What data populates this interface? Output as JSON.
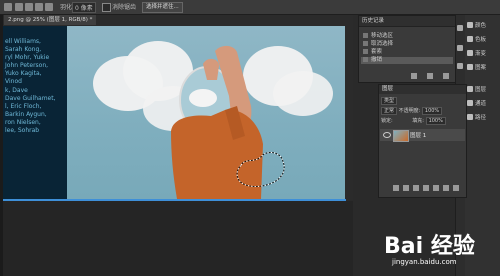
{
  "options_bar": {
    "feather_label": "羽化:",
    "feather_value": "0 像素",
    "antialias_label": "消除锯齿",
    "select_subject_label": "选择并遮住..."
  },
  "document": {
    "tab_title": "2.png @ 25% (图层 1, RGB/8) *",
    "credit_names": [
      "ell Williams,",
      "Sarah Kong,",
      "ryl Mohr, Yukie",
      "John Peterson,",
      "Yuko Kagita,",
      "Vinod",
      "k, Dave",
      "Dave Guilhamet,",
      "l, Eric Floch,",
      "Barkin Aygun,",
      "ron Nielsen,",
      "lee, Sohrab"
    ]
  },
  "history_panel": {
    "title": "历史记录",
    "items": [
      {
        "label": "移动选区"
      },
      {
        "label": "取消选择"
      },
      {
        "label": "套索"
      },
      {
        "label": "撤销",
        "selected": true
      }
    ]
  },
  "right_panel": {
    "items": [
      {
        "label": "颜色",
        "icon": "color-icon"
      },
      {
        "label": "色板",
        "icon": "swatches-icon"
      },
      {
        "label": "渐变",
        "icon": "gradient-icon"
      },
      {
        "label": "图案",
        "icon": "pattern-icon"
      },
      {
        "label": "图层",
        "icon": "layers-icon"
      },
      {
        "label": "通道",
        "icon": "channels-icon"
      },
      {
        "label": "路径",
        "icon": "paths-icon"
      }
    ]
  },
  "layers_panel": {
    "tab_label": "图层",
    "filter_label": "类型",
    "blend_mode": "正常",
    "opacity_label": "不透明度:",
    "opacity_value": "100%",
    "lock_label": "锁定:",
    "fill_label": "填充:",
    "fill_value": "100%",
    "layer_name": "图层 1"
  },
  "watermark": {
    "logo_text": "Bai 经验",
    "url": "jingyan.baidu.com"
  },
  "colors": {
    "selection_accent": "#3e8fd8",
    "sky": "#85b3c3",
    "shirt": "#c4642a"
  }
}
